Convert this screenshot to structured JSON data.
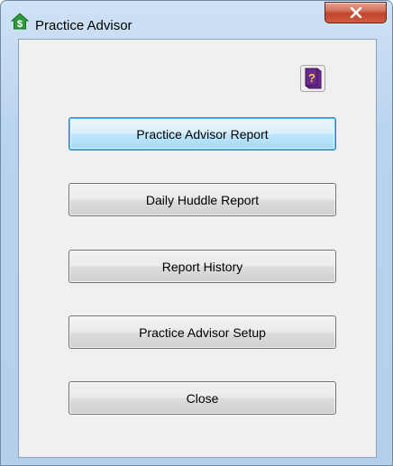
{
  "window": {
    "title": "Practice Advisor",
    "icons": {
      "app": "dollar-house-icon",
      "close": "close-icon",
      "help": "help-book-icon"
    }
  },
  "buttons": [
    {
      "label": "Practice Advisor Report",
      "default": true
    },
    {
      "label": "Daily Huddle Report"
    },
    {
      "label": "Report History"
    },
    {
      "label": "Practice Advisor Setup"
    },
    {
      "label": "Close"
    }
  ],
  "colors": {
    "frame": "#b9d3ee",
    "client": "#f0f0f0",
    "close_button": "#c2442c",
    "default_button_border": "#3c7fb1"
  }
}
